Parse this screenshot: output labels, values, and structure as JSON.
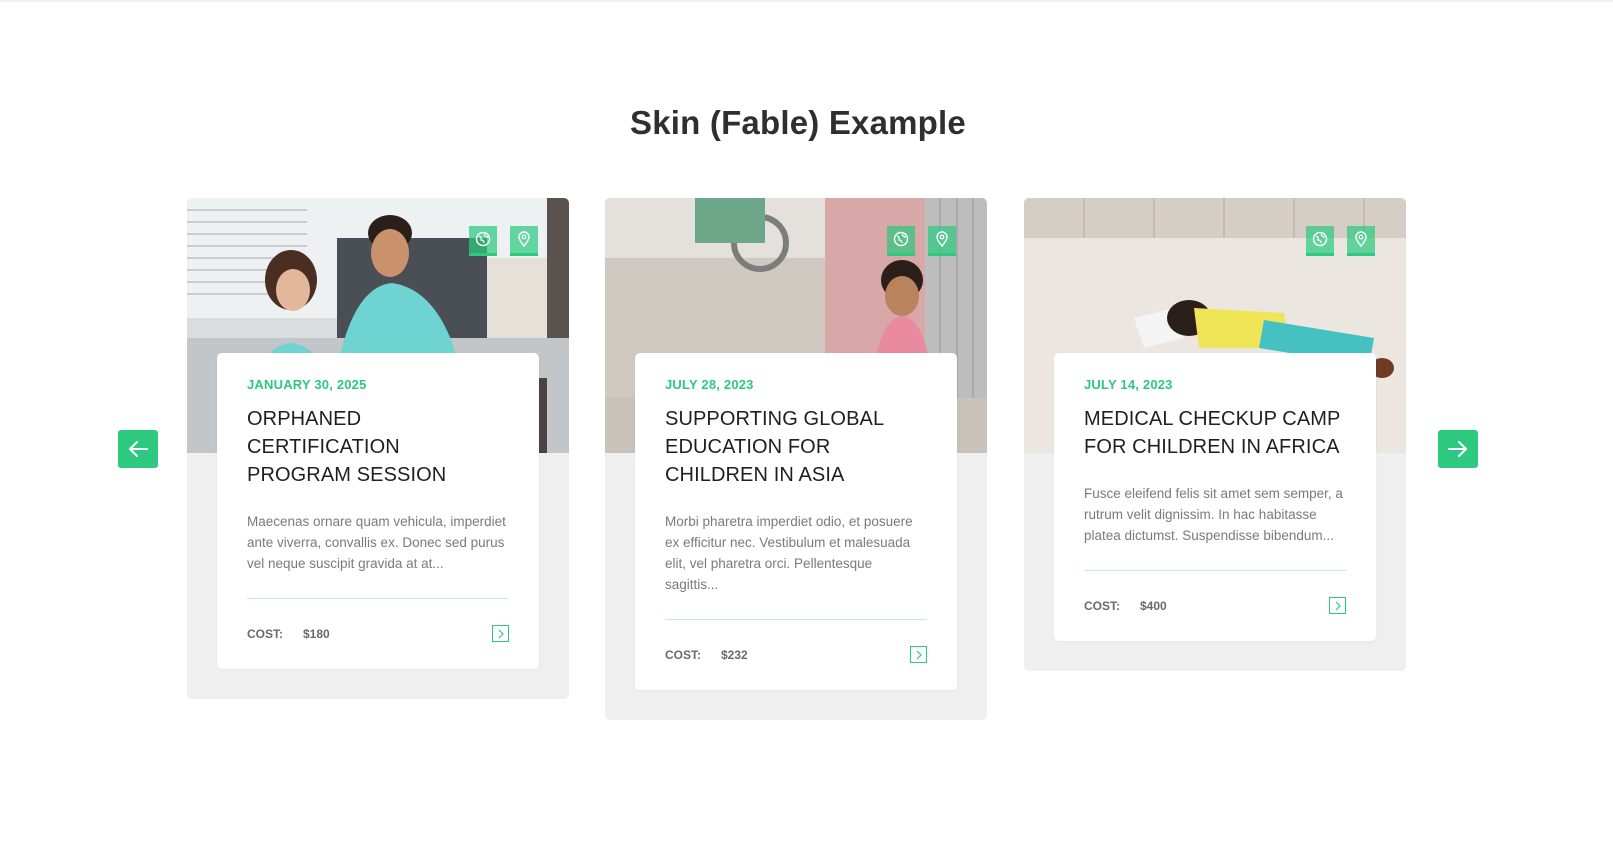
{
  "section": {
    "title": "Skin (Fable) Example"
  },
  "carousel": {
    "prev_icon": "arrow-left-icon",
    "next_icon": "arrow-right-icon",
    "accent_color": "#2cc97f"
  },
  "cards": [
    {
      "date": "JANUARY 30, 2025",
      "title": "ORPHANED CERTIFICATION PROGRAM SESSION",
      "excerpt": "Maecenas ornare quam vehicula, imperdiet ante viverra, convallis ex. Donec sed purus vel neque suscipit gravida at at...",
      "cost_label": "COST:",
      "cost_value": "$180",
      "icons": [
        "globe-icon",
        "map-pin-icon",
        "chevron-right-icon"
      ]
    },
    {
      "date": "JULY 28, 2023",
      "title": "SUPPORTING GLOBAL EDUCATION FOR CHILDREN IN ASIA",
      "excerpt": "Morbi pharetra imperdiet odio, et posuere ex efficitur nec. Vestibulum et malesuada elit, vel pharetra orci. Pellentesque sagittis...",
      "cost_label": "COST:",
      "cost_value": "$232",
      "icons": [
        "globe-icon",
        "map-pin-icon",
        "chevron-right-icon"
      ]
    },
    {
      "date": "JULY 14, 2023",
      "title": "MEDICAL CHECKUP CAMP FOR CHILDREN IN AFRICA",
      "excerpt": "Fusce eleifend felis sit amet sem semper, a rutrum velit dignissim. In hac habitasse platea dictumst. Suspendisse bibendum...",
      "cost_label": "COST:",
      "cost_value": "$400",
      "icons": [
        "globe-icon",
        "map-pin-icon",
        "chevron-right-icon"
      ]
    }
  ]
}
